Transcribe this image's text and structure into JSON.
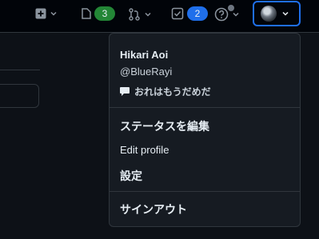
{
  "header": {
    "issues_count": "3",
    "notifications_count": "2"
  },
  "user_menu": {
    "display_name": "Hikari Aoi",
    "username": "@BlueRayi",
    "status_text": "おれはもうだめだ",
    "items": [
      {
        "label": "ステータスを編集"
      },
      {
        "label": "Edit profile"
      },
      {
        "label": "設定"
      },
      {
        "label": "サインアウト"
      }
    ]
  }
}
